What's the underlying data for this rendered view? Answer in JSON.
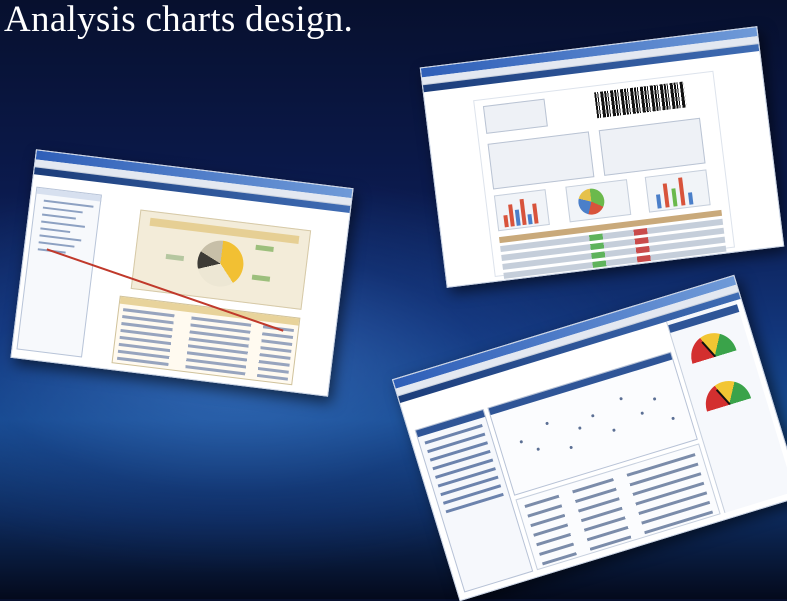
{
  "slide": {
    "title": "Analysis charts design."
  },
  "screenshots": [
    {
      "id": "pie-report",
      "description_icon": "pie-chart-report-window"
    },
    {
      "id": "document-report",
      "description_icon": "barcode-document-window"
    },
    {
      "id": "dashboard",
      "description_icon": "gauge-dashboard-window"
    }
  ],
  "colors": {
    "background_top": "#07102e",
    "background_mid": "#184e93",
    "title_text": "#ffffff",
    "window_chrome": "#2f5fb8",
    "pie_highlight": "#f2c033",
    "gauge_red": "#d32f2f",
    "gauge_yellow": "#f2c633",
    "gauge_green": "#3aa34a"
  }
}
